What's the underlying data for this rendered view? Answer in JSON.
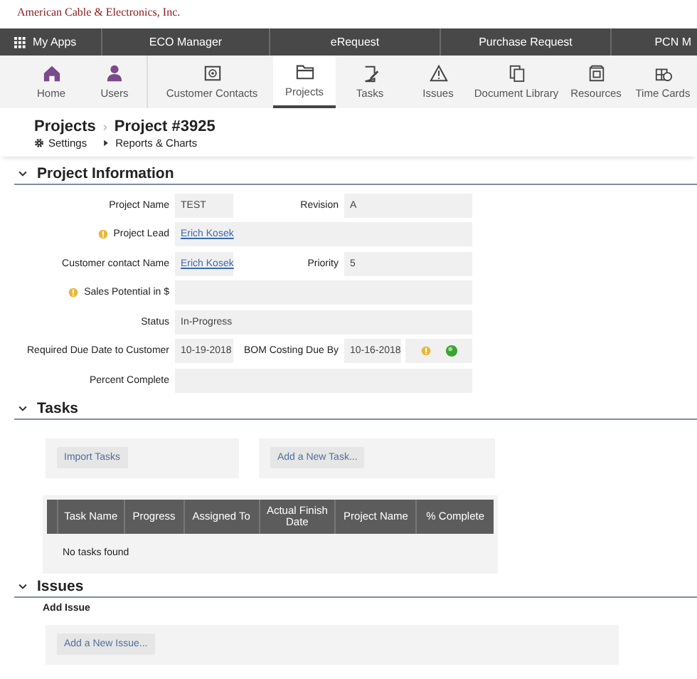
{
  "company": "American Cable & Electronics, Inc.",
  "app_bar": [
    {
      "label": "My Apps",
      "selected": false
    },
    {
      "label": "ECO Manager",
      "selected": false
    },
    {
      "label": "eRequest",
      "selected": false
    },
    {
      "label": "Purchase Request",
      "selected": false
    },
    {
      "label": "PCN M",
      "selected": false
    }
  ],
  "modules": [
    {
      "label": "Home",
      "selected": false
    },
    {
      "label": "Users",
      "selected": false
    },
    {
      "label": "Customer Contacts",
      "selected": false
    },
    {
      "label": "Projects",
      "selected": true
    },
    {
      "label": "Tasks",
      "selected": false
    },
    {
      "label": "Issues",
      "selected": false
    },
    {
      "label": "Document Library",
      "selected": false
    },
    {
      "label": "Resources",
      "selected": false
    },
    {
      "label": "Time Cards",
      "selected": false
    }
  ],
  "breadcrumb": {
    "parent": "Projects",
    "separator": "›",
    "current": "Project #3925"
  },
  "links": [
    {
      "label": "Settings"
    },
    {
      "label": "Reports & Charts"
    }
  ],
  "sections": [
    {
      "title": "Project Information",
      "expanded": true
    },
    {
      "title": "Tasks",
      "expanded": true
    },
    {
      "title": "Issues",
      "expanded": true
    }
  ],
  "form_rows": [
    {
      "fields": [
        {
          "label": "Project Name",
          "value": "TEST",
          "kind": "text",
          "info": false
        },
        {
          "label": "Revision",
          "value": "A",
          "kind": "text",
          "info": false
        }
      ]
    },
    {
      "fields": [
        {
          "label": "Project Lead",
          "value": "Erich Kosek",
          "kind": "link",
          "info": true
        }
      ]
    },
    {
      "fields": [
        {
          "label": "Customer contact Name",
          "value": "Erich Kosek",
          "kind": "link",
          "info": false
        },
        {
          "label": "Priority",
          "value": "5",
          "kind": "text",
          "info": false
        }
      ]
    },
    {
      "fields": [
        {
          "label": "Sales Potential in $",
          "info": true
        }
      ]
    },
    {
      "fields": [
        {
          "label": "Status",
          "value": "In-Progress",
          "kind": "text",
          "info": false
        }
      ]
    },
    {
      "fields": [
        {
          "label": "Required Due Date to Customer",
          "value": "10-19-2018",
          "kind": "text",
          "info": false
        },
        {
          "label": "BOM Costing Due By",
          "value": "10-16-2018",
          "kind": "text",
          "info": false,
          "alert": true
        }
      ]
    },
    {
      "fields": [
        {
          "label": "Percent Complete",
          "info": false
        }
      ]
    }
  ],
  "tasks": {
    "buttons": [
      "Import Tasks",
      "Add a New Task..."
    ],
    "table": {
      "columns": [
        "Task Name",
        "Progress",
        "Assigned To",
        "Actual Finish Date",
        "Project Name",
        "% Complete"
      ],
      "empty_message": "No tasks found"
    }
  },
  "issues": {
    "label": "Add Issue",
    "button": "Add a New Issue..."
  }
}
